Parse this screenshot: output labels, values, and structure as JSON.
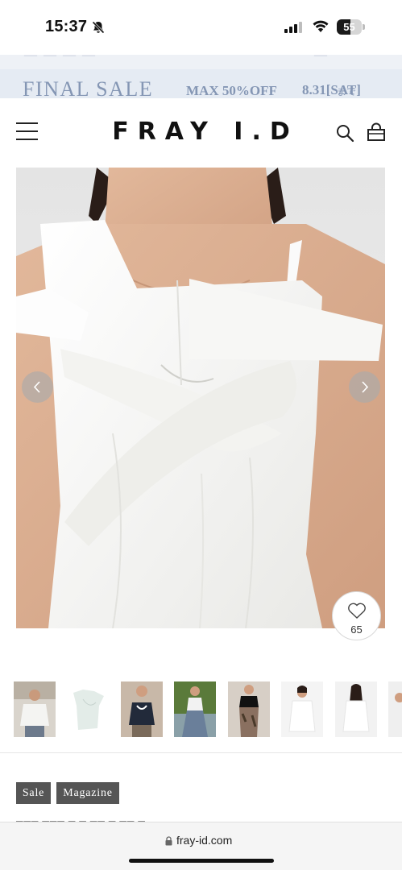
{
  "status_bar": {
    "time": "15:37",
    "battery": "55",
    "battery_fraction": 0.55
  },
  "banner": {
    "title": "FINAL SALE",
    "max": "MAX 50%OFF",
    "date": "8.31[SAT]",
    "until": "まで"
  },
  "header": {
    "logo": "FRAY I.D"
  },
  "product": {
    "favorite_count": "65",
    "thumbnail_count": 8
  },
  "tags": [
    {
      "label": "Sale"
    },
    {
      "label": "Magazine"
    }
  ],
  "browser": {
    "url": "fray-id.com"
  },
  "colors": {
    "banner_bg": "#e5ebf3",
    "banner_text": "#8496b4",
    "tag_bg": "#555555"
  },
  "icons": [
    "bell-slash-icon",
    "signal-icon",
    "wifi-icon",
    "battery-icon",
    "hamburger-menu-icon",
    "search-icon",
    "shopping-bag-icon",
    "chevron-left-icon",
    "chevron-right-icon",
    "heart-icon",
    "lock-icon"
  ]
}
